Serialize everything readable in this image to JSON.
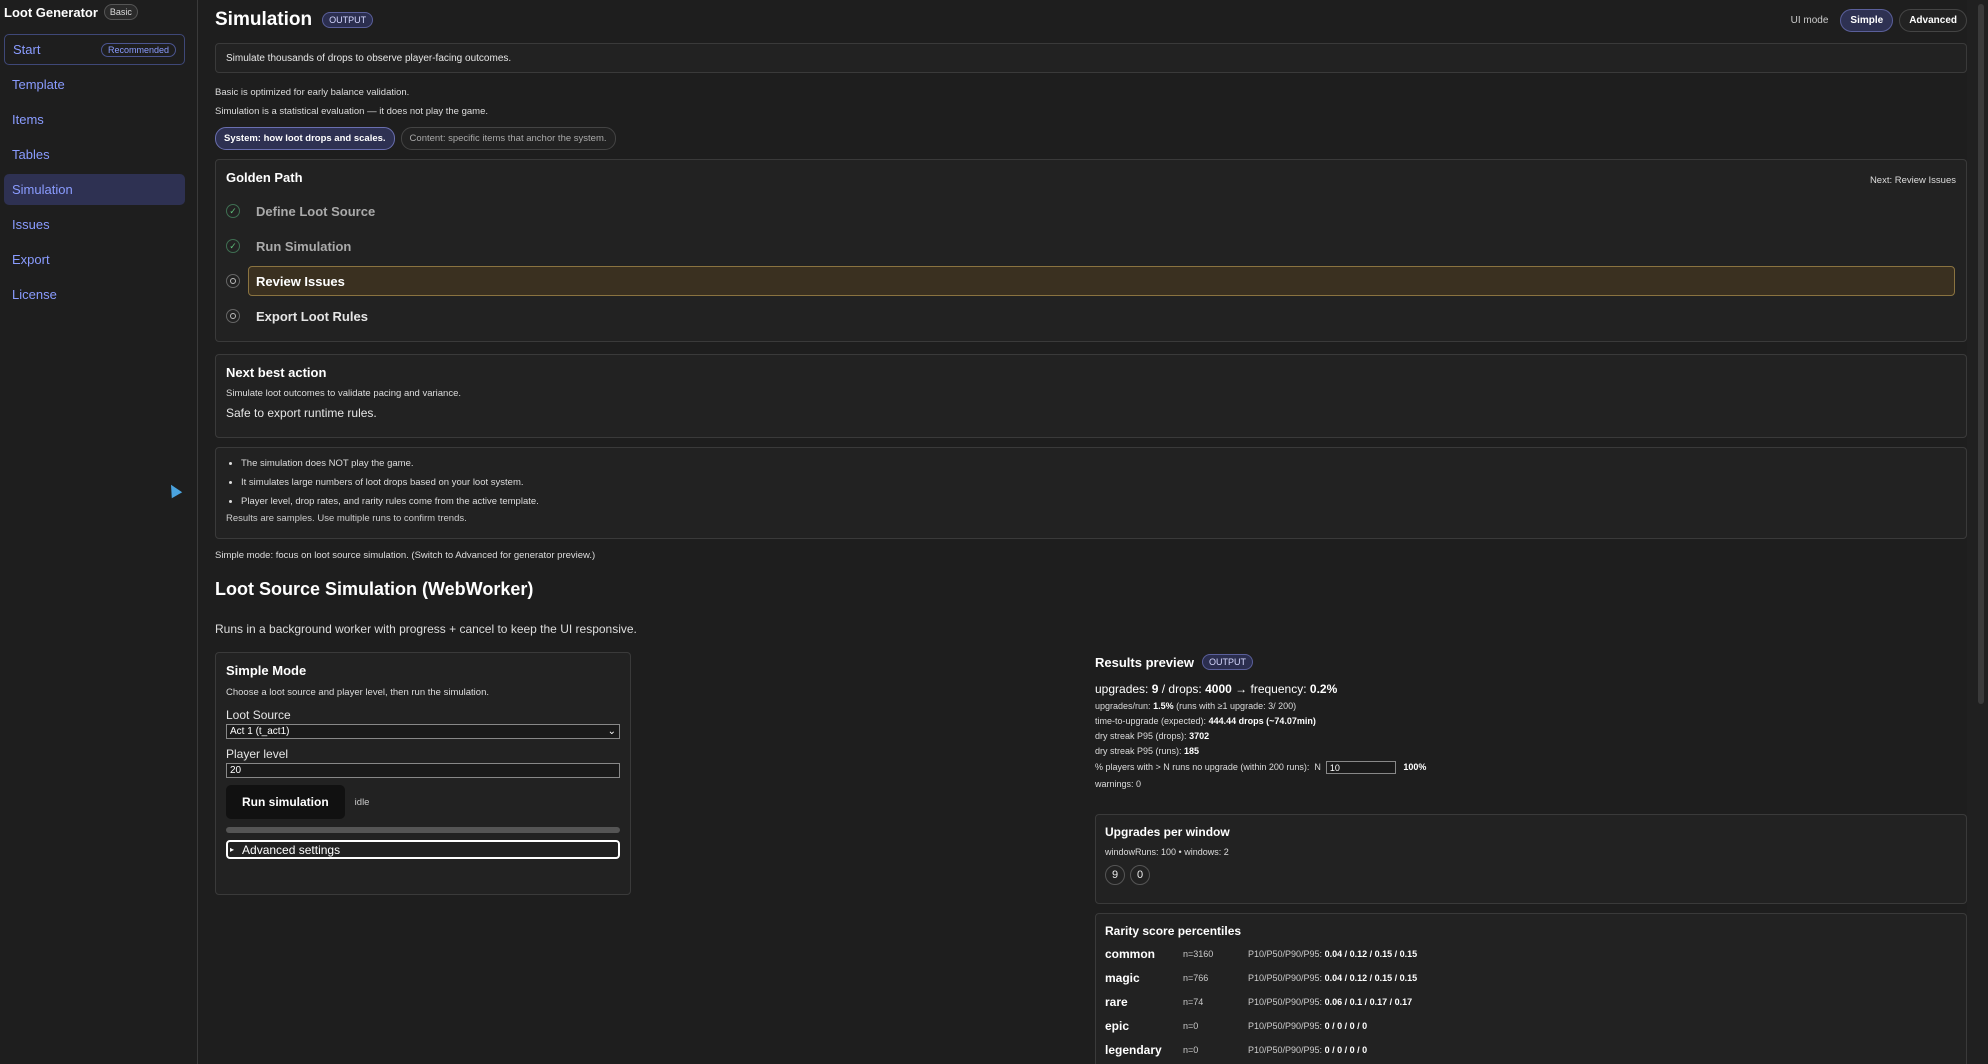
{
  "sidebar": {
    "brand": "Loot Generator",
    "badge": "Basic",
    "items": [
      {
        "label": "Start",
        "tag": "Recommended"
      },
      {
        "label": "Template"
      },
      {
        "label": "Items"
      },
      {
        "label": "Tables"
      },
      {
        "label": "Simulation"
      },
      {
        "label": "Issues"
      },
      {
        "label": "Export"
      },
      {
        "label": "License"
      }
    ]
  },
  "header": {
    "title": "Simulation",
    "badge": "OUTPUT",
    "ui_mode_label": "UI mode",
    "mode_simple": "Simple",
    "mode_advanced": "Advanced"
  },
  "intro": {
    "box_text": "Simulate thousands of drops to observe player-facing outcomes.",
    "line1": "Basic is optimized for early balance validation.",
    "line2": "Simulation is a statistical evaluation — it does not play the game.",
    "chip_system": "System: how loot drops and scales.",
    "chip_content": "Content: specific items that anchor the system."
  },
  "golden_path": {
    "title": "Golden Path",
    "next": "Next: Review Issues",
    "steps": [
      {
        "label": "Define Loot Source",
        "icon": "check"
      },
      {
        "label": "Run Simulation",
        "icon": "check"
      },
      {
        "label": "Review Issues",
        "icon": "circle"
      },
      {
        "label": "Export Loot Rules",
        "icon": "circle"
      }
    ]
  },
  "next_best_action": {
    "title": "Next best action",
    "desc": "Simulate loot outcomes to validate pacing and variance.",
    "safe": "Safe to export runtime rules."
  },
  "info_bullets": {
    "items": [
      "The simulation does NOT play the game.",
      "It simulates large numbers of loot drops based on your loot system.",
      "Player level, drop rates, and rarity rules come from the active template."
    ],
    "note": "Results are samples. Use multiple runs to confirm trends."
  },
  "simple_note": "Simple mode: focus on loot source simulation. (Switch to Advanced for generator preview.)",
  "sim_section": {
    "title": "Loot Source Simulation (WebWorker)",
    "desc": "Runs in a background worker with progress + cancel to keep the UI responsive."
  },
  "simple_mode": {
    "title": "Simple Mode",
    "desc": "Choose a loot source and player level, then run the simulation.",
    "loot_source_label": "Loot Source",
    "loot_source_value": "Act 1 (t_act1)",
    "player_level_label": "Player level",
    "player_level_value": "20",
    "run_label": "Run simulation",
    "status": "idle",
    "progress": 0,
    "advanced_label": "Advanced settings"
  },
  "results": {
    "title": "Results preview",
    "badge": "OUTPUT",
    "upgrades_label": "upgrades:",
    "upgrades": "9",
    "drops_label": "/ drops:",
    "drops": "4000",
    "freq_label": "→ frequency:",
    "frequency": "0.2%",
    "upgrades_run_label": "upgrades/run:",
    "upgrades_run": "1.5%",
    "upgrades_run_note": "(runs with ≥1 upgrade: 3/ 200)",
    "ttu_label": "time-to-upgrade (expected):",
    "ttu": "444.44 drops (~74.07min)",
    "dry_drops_label": "dry streak P95 (drops):",
    "dry_drops": "3702",
    "dry_runs_label": "dry streak P95 (runs):",
    "dry_runs": "185",
    "pct_label": "% players with > N runs no upgrade (within 200 runs):",
    "n_label": "N",
    "n_value": "10",
    "pct_value": "100%",
    "warnings": "warnings: 0"
  },
  "upgrades_window": {
    "title": "Upgrades per window",
    "desc": "windowRuns: 100 • windows: 2",
    "counts": [
      "9",
      "0"
    ]
  },
  "rarity": {
    "title": "Rarity score percentiles",
    "p_label": "P10/P50/P90/P95:",
    "rows": [
      {
        "name": "common",
        "n": "n=3160",
        "p": "0.04 / 0.12 / 0.15 / 0.15"
      },
      {
        "name": "magic",
        "n": "n=766",
        "p": "0.04 / 0.12 / 0.15 / 0.15"
      },
      {
        "name": "rare",
        "n": "n=74",
        "p": "0.06 / 0.1 / 0.17 / 0.17"
      },
      {
        "name": "epic",
        "n": "n=0",
        "p": "0 / 0 / 0 / 0"
      },
      {
        "name": "legendary",
        "n": "n=0",
        "p": "0 / 0 / 0 / 0"
      }
    ]
  }
}
